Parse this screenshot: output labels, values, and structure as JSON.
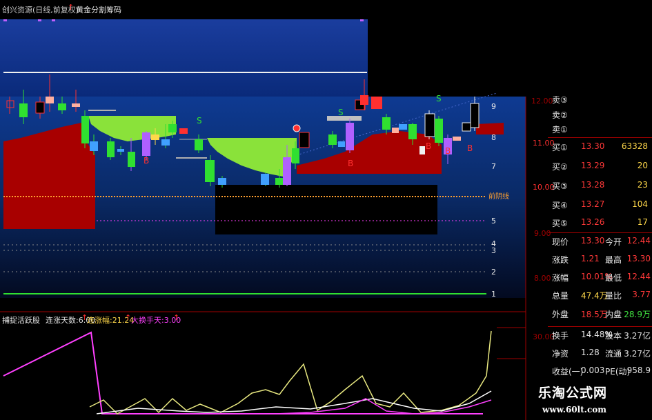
{
  "chart": {
    "title": "创兴资源(日线,前复权)",
    "indicator_name": "黄金分割筹码",
    "left_axis_labels": [
      "9",
      "8",
      "7",
      "6",
      "5",
      "4",
      "3",
      "2",
      "1"
    ],
    "right_axis_labels": [
      "12.00",
      "11.00",
      "10.00",
      "9.00",
      "8.00"
    ],
    "annotation_line_label": "前阴线",
    "markers_s": [
      "S",
      "S",
      "S"
    ],
    "markers_b": [
      "B",
      "B",
      "B",
      "B",
      "B"
    ]
  },
  "indicator": {
    "name": "捕捉活跃股",
    "params": [
      {
        "label": "连涨天数:",
        "value": "6.00",
        "color": "#e0e0e0"
      },
      {
        "label": "连涨幅:",
        "value": "21.24",
        "color": "#ffd84a"
      },
      {
        "label": "大换手天:",
        "value": "3.00",
        "color": "#ff40ff"
      }
    ],
    "axis_label": "30.00"
  },
  "orderbook": {
    "sell": [
      {
        "label": "卖③",
        "price": "",
        "vol": ""
      },
      {
        "label": "卖②",
        "price": "",
        "vol": ""
      },
      {
        "label": "卖①",
        "price": "",
        "vol": ""
      }
    ],
    "buy": [
      {
        "label": "买①",
        "price": "13.30",
        "vol": "63328"
      },
      {
        "label": "买②",
        "price": "13.29",
        "vol": "20"
      },
      {
        "label": "买③",
        "price": "13.28",
        "vol": "23"
      },
      {
        "label": "买④",
        "price": "13.27",
        "vol": "104"
      },
      {
        "label": "买⑤",
        "price": "13.26",
        "vol": "17"
      }
    ]
  },
  "stats": [
    {
      "k1": "现价",
      "v1": "13.30",
      "c1": "#ff3838",
      "k2": "今开",
      "v2": "12.44",
      "c2": "#ff3838"
    },
    {
      "k1": "涨跌",
      "v1": "1.21",
      "c1": "#ff3838",
      "k2": "最高",
      "v2": "13.30",
      "c2": "#ff3838"
    },
    {
      "k1": "涨幅",
      "v1": "10.01%",
      "c1": "#ff3838",
      "k2": "最低",
      "v2": "12.44",
      "c2": "#ff3838"
    },
    {
      "k1": "总量",
      "v1": "47.4万",
      "c1": "#ffd84a",
      "k2": "量比",
      "v2": "3.77",
      "c2": "#ff3838"
    },
    {
      "k1": "外盘",
      "v1": "18.5万",
      "c1": "#ff3838",
      "k2": "内盘",
      "v2": "28.9万",
      "c2": "#40e040"
    },
    {
      "k1": "换手",
      "v1": "14.48%",
      "c1": "#e0e0e0",
      "k2": "股本",
      "v2": "3.27亿",
      "c2": "#e0e0e0"
    },
    {
      "k1": "净资",
      "v1": "1.28",
      "c1": "#e0e0e0",
      "k2": "流通",
      "v2": "3.27亿",
      "c2": "#e0e0e0"
    },
    {
      "k1": "收益(一)",
      "v1": "0.003",
      "c1": "#e0e0e0",
      "k2": "PE(动)",
      "v2": "958.9",
      "c2": "#e0e0e0"
    }
  ],
  "watermark": {
    "name": "乐淘公式网",
    "url": "www.60lt.com"
  },
  "colors": {
    "up": "#ff3030",
    "down": "#30e030",
    "chip_red": "#a80000",
    "chip_green": "#8ae23a",
    "gold_line": "#ffa030",
    "magenta": "#ff40ff"
  }
}
